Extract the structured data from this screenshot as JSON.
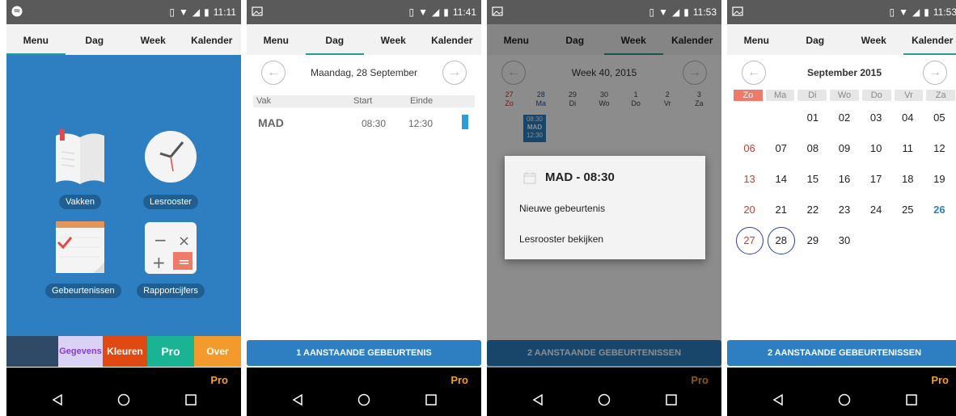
{
  "status": {
    "s1_time": "11:11",
    "s2_time": "11:41",
    "s3_time": "11:53",
    "s4_time": "11:53"
  },
  "tabs": [
    "Menu",
    "Dag",
    "Week",
    "Kalender"
  ],
  "nav": {
    "pro_label": "Pro"
  },
  "screen1": {
    "items": [
      {
        "label": "Vakken",
        "icon": "book-icon"
      },
      {
        "label": "Lesrooster",
        "icon": "clock-icon"
      },
      {
        "label": "Gebeurtenissen",
        "icon": "notepad-check-icon"
      },
      {
        "label": "Rapportcijfers",
        "icon": "calculator-icon"
      }
    ],
    "tiles": [
      {
        "label": "",
        "color": "#2f4a66"
      },
      {
        "label": "Gegevens",
        "color": "#d9d2f5"
      },
      {
        "label": "Kleuren",
        "color": "#e04a12"
      },
      {
        "label": "Pro",
        "color": "#1ab394"
      },
      {
        "label": "Over",
        "color": "#f29a2c"
      }
    ]
  },
  "screen2": {
    "date_title": "Maandag, 28 September",
    "table_headers": {
      "vak": "Vak",
      "start": "Start",
      "einde": "Einde"
    },
    "rows": [
      {
        "vak": "MAD",
        "start": "08:30",
        "einde": "12:30",
        "color": "#2d9cdb"
      }
    ],
    "button_label": "1 AANSTAANDE GEBEURTENIS"
  },
  "screen3": {
    "week_title": "Week 40, 2015",
    "days": [
      {
        "num": "27",
        "name": "Zo"
      },
      {
        "num": "28",
        "name": "Ma"
      },
      {
        "num": "29",
        "name": "Di"
      },
      {
        "num": "30",
        "name": "Wo"
      },
      {
        "num": "1",
        "name": "Do"
      },
      {
        "num": "2",
        "name": "Vr"
      },
      {
        "num": "3",
        "name": "Za"
      }
    ],
    "lesson_block": {
      "start": "08:30",
      "vak": "MAD",
      "end": "12:30"
    },
    "dialog": {
      "title": "MAD - 08:30",
      "options": [
        "Nieuwe gebeurtenis",
        "Lesrooster bekijken"
      ]
    },
    "button_label": "2 AANSTAANDE GEBEURTENISSEN"
  },
  "screen4": {
    "month_title": "September 2015",
    "weekdays": [
      "Zo",
      "Ma",
      "Di",
      "Wo",
      "Do",
      "Vr",
      "Za"
    ],
    "weeks": [
      [
        "",
        "",
        "01",
        "02",
        "03",
        "04",
        "05"
      ],
      [
        "06",
        "07",
        "08",
        "09",
        "10",
        "11",
        "12"
      ],
      [
        "13",
        "14",
        "15",
        "16",
        "17",
        "18",
        "19"
      ],
      [
        "20",
        "21",
        "22",
        "23",
        "24",
        "25",
        "26"
      ],
      [
        "27",
        "28",
        "29",
        "30",
        "",
        "",
        ""
      ]
    ],
    "highlighted_today": "26",
    "circled": [
      "27",
      "28"
    ],
    "button_label": "2 AANSTAANDE GEBEURTENISSEN"
  }
}
